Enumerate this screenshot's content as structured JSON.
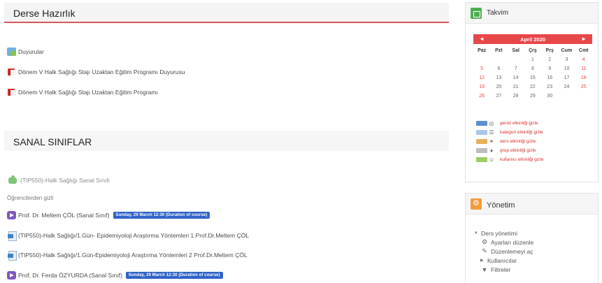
{
  "sections": {
    "derse_hazirlik": {
      "title": "Derse Hazırlık",
      "items": [
        {
          "icon": "forum-icon",
          "label": "Duyurular"
        },
        {
          "icon": "book-icon",
          "label": "Dönem V Halk Sağlığı Stajı Uzaktan Eğitim Programı Duyurusu"
        },
        {
          "icon": "book-icon",
          "label": "Dönem V Halk Sağlığı Stajı Uzaktan Eğitim Programı"
        }
      ]
    },
    "sanal_siniflar": {
      "title": "SANAL SINIFLAR",
      "items": [
        {
          "icon": "puzzle-icon",
          "label": "(TIP550)-Halk Sağlığı Sanal Sınıfı"
        },
        {
          "icon": "virtual-class-icon",
          "label": "Prof. Dr. Meltem ÇÖL (Sanal Sınıf)",
          "badge": "Sunday, 29 March 12:30 (Duration of course)"
        },
        {
          "icon": "file-icon",
          "label": "(TIP550)-Halk Sağlığı/1.Gün- Epidemiyoloji Araştırma Yöntemleri 1 Prof.Dr.Meltem ÇÖL"
        },
        {
          "icon": "file-icon",
          "label": "(TIP550)-Halk Sağlığı/1.Gün-Epidemiyoloji Araştırma Yöntemleri 2 Prof.Dr.Meltem ÇÖL"
        },
        {
          "icon": "virtual-class-icon",
          "label": "Prof. Dr. Ferda ÖZYURDA (Sanal Sınıf)",
          "badge": "Sunday, 29 March 12:30 (Duration of course)"
        }
      ],
      "hidden_note": "Öğrencilerden gizli"
    }
  },
  "calendar": {
    "title": "Takvim",
    "prev": "◄",
    "next": "►",
    "month": "April 2020",
    "weekdays": [
      "Paz",
      "Pzt",
      "Sal",
      "Çrş",
      "Prş",
      "Cum",
      "Cmt"
    ],
    "weeks": [
      [
        "",
        "",
        "",
        "1",
        "2",
        "3",
        "4"
      ],
      [
        "5",
        "6",
        "7",
        "8",
        "9",
        "10",
        "11"
      ],
      [
        "12",
        "13",
        "14",
        "15",
        "16",
        "17",
        "18"
      ],
      [
        "19",
        "20",
        "21",
        "22",
        "23",
        "24",
        "25"
      ],
      [
        "26",
        "27",
        "28",
        "29",
        "30",
        "",
        ""
      ]
    ],
    "today": "19",
    "events": [
      {
        "label": "genel etkinliği gizle",
        "color": "#5c8fd6",
        "icon": "globe-icon",
        "glyph": "◎"
      },
      {
        "label": "kategori etkinliği gizle",
        "color": "#a8c6ea",
        "icon": "list-icon",
        "glyph": "☰"
      },
      {
        "label": "ders etkinliği gizle",
        "color": "#e6b05a",
        "icon": "course-icon",
        "glyph": "✶"
      },
      {
        "label": "grup etkinliği gizle",
        "color": "#bdbdbd",
        "icon": "group-icon",
        "glyph": "♦"
      },
      {
        "label": "kullanıcı etkinliği gizle",
        "color": "#9ccc65",
        "icon": "user-icon",
        "glyph": "☺"
      }
    ]
  },
  "admin": {
    "title": "Yönetim",
    "tree": [
      {
        "level": 1,
        "toggle": "▼",
        "icon": "",
        "label": "Ders yönetimi"
      },
      {
        "level": 2,
        "toggle": "",
        "icon": "⚙",
        "label": "Ayarları düzenle"
      },
      {
        "level": 2,
        "toggle": "",
        "icon": "✎",
        "label": "Düzenlemeyi aç"
      },
      {
        "level": 2,
        "toggle": "▶",
        "icon": "",
        "label": "Kullanıcılar"
      },
      {
        "level": 2,
        "toggle": "",
        "icon": "▼",
        "label": "Filtreler"
      }
    ]
  },
  "colors": {
    "accent_red": "#e8474a",
    "badge_blue": "#2f63c8",
    "calendar_green": "#4caf50",
    "admin_orange": "#f59a3b"
  }
}
